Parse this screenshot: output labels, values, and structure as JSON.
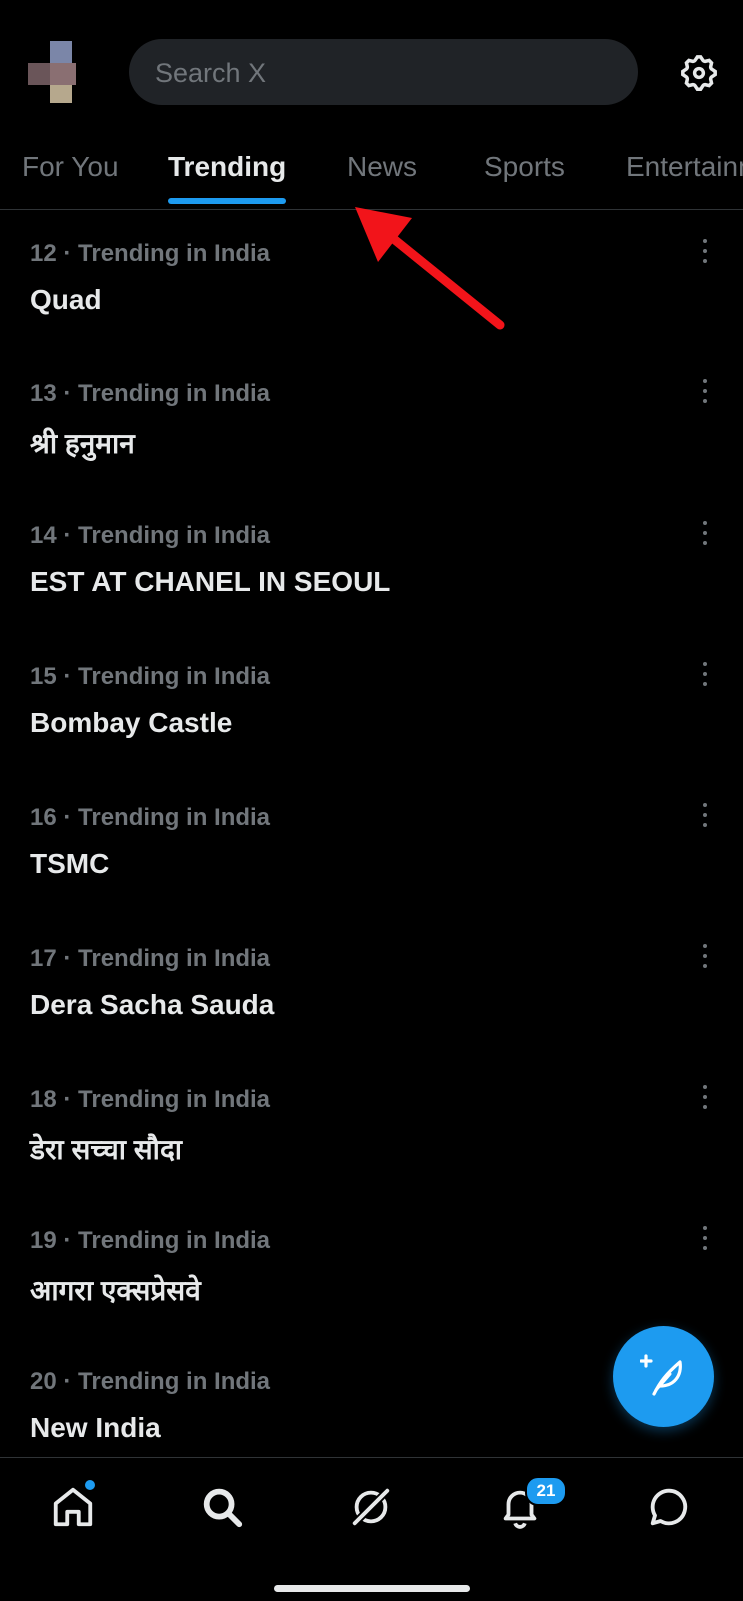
{
  "search": {
    "placeholder": "Search X"
  },
  "tabs": [
    {
      "label": "For You"
    },
    {
      "label": "Trending",
      "active": true
    },
    {
      "label": "News"
    },
    {
      "label": "Sports"
    },
    {
      "label": "Entertainment"
    }
  ],
  "trends": [
    {
      "meta": "12 · Trending in India",
      "title": "Quad"
    },
    {
      "meta": "13 · Trending in India",
      "title": "श्री हनुमान"
    },
    {
      "meta": "14 · Trending in India",
      "title": "EST AT CHANEL IN SEOUL"
    },
    {
      "meta": "15 · Trending in India",
      "title": "Bombay Castle"
    },
    {
      "meta": "16 · Trending in India",
      "title": "TSMC"
    },
    {
      "meta": "17 · Trending in India",
      "title": "Dera Sacha Sauda"
    },
    {
      "meta": "18 · Trending in India",
      "title": "डेरा सच्चा सौदा"
    },
    {
      "meta": "19 · Trending in India",
      "title": "आगरा एक्सप्रेसवे"
    },
    {
      "meta": "20 · Trending in India",
      "title": "New India"
    }
  ],
  "nav": {
    "notifications_badge": "21",
    "icons": [
      "home-icon",
      "search-icon",
      "grok-icon",
      "bell-icon",
      "messages-icon"
    ]
  },
  "colors": {
    "accent": "#1d9bf0",
    "background": "#000000",
    "secondary_text": "#71767b",
    "annotation_arrow": "#f2141a"
  }
}
